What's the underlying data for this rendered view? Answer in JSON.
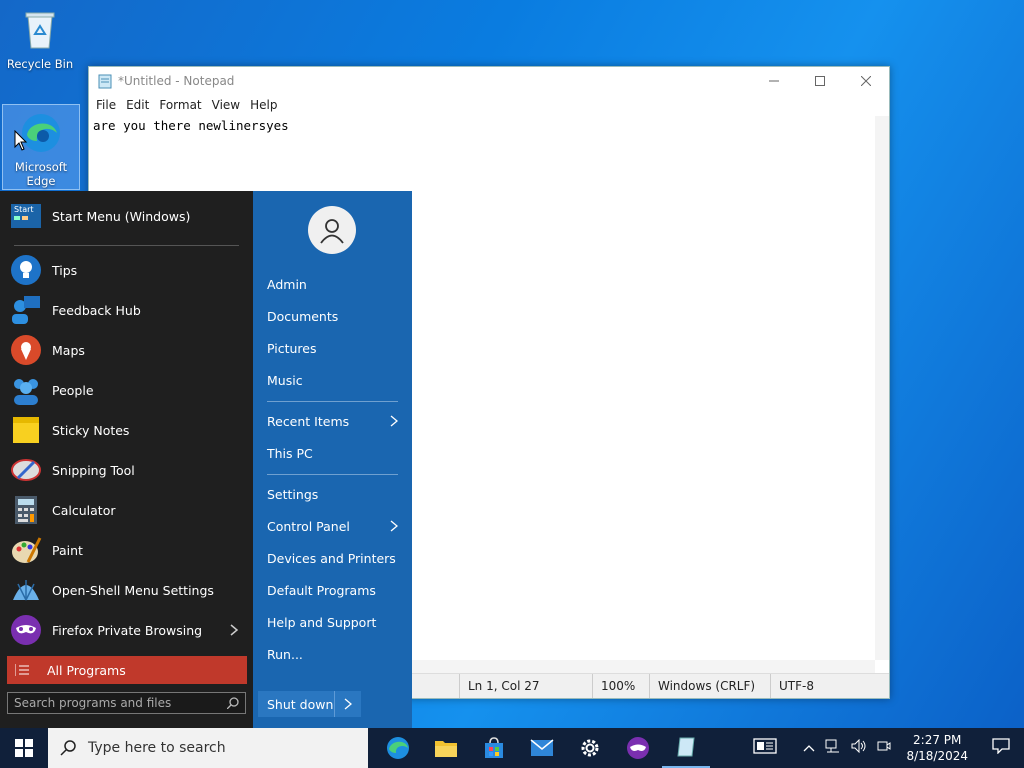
{
  "desktop": {
    "icons": [
      {
        "label": "Recycle Bin"
      },
      {
        "label": "Microsoft Edge"
      }
    ]
  },
  "notepad": {
    "title": "*Untitled - Notepad",
    "menu": [
      "File",
      "Edit",
      "Format",
      "View",
      "Help"
    ],
    "content": "are you there newlinersyes",
    "status": {
      "position": "Ln 1, Col 27",
      "zoom": "100%",
      "line_ending": "Windows (CRLF)",
      "encoding": "UTF-8"
    }
  },
  "start_menu": {
    "header": "Start Menu (Windows)",
    "pinned": [
      {
        "label": "Tips"
      },
      {
        "label": "Feedback Hub"
      },
      {
        "label": "Maps"
      },
      {
        "label": "People"
      },
      {
        "label": "Sticky Notes"
      },
      {
        "label": "Snipping Tool"
      },
      {
        "label": "Calculator"
      },
      {
        "label": "Paint"
      },
      {
        "label": "Open-Shell Menu Settings"
      },
      {
        "label": "Firefox Private Browsing"
      }
    ],
    "all_programs": "All Programs",
    "search_placeholder": "Search programs and files",
    "right": {
      "user": "Admin",
      "items1": [
        "Documents",
        "Pictures",
        "Music"
      ],
      "recent": "Recent Items",
      "this_pc": "This PC",
      "settings": "Settings",
      "control_panel": "Control Panel",
      "items3": [
        "Devices and Printers",
        "Default Programs",
        "Help and Support",
        "Run..."
      ],
      "shutdown": "Shut down"
    }
  },
  "taskbar": {
    "search_placeholder": "Type here to search",
    "time": "2:27 PM",
    "date": "8/18/2024"
  }
}
